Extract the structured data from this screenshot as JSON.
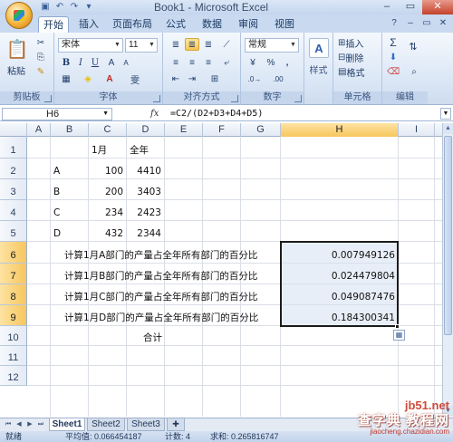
{
  "window": {
    "title": "Book1 - Microsoft Excel",
    "controls": [
      "–",
      "▭",
      "✕"
    ]
  },
  "quick_access": [
    "save-icon",
    "undo-icon",
    "redo-icon",
    "customize-icon"
  ],
  "tabs": [
    {
      "label": "开始",
      "active": true
    },
    {
      "label": "插入",
      "active": false
    },
    {
      "label": "页面布局",
      "active": false
    },
    {
      "label": "公式",
      "active": false
    },
    {
      "label": "数据",
      "active": false
    },
    {
      "label": "审阅",
      "active": false
    },
    {
      "label": "视图",
      "active": false
    }
  ],
  "ribbon": {
    "clipboard": {
      "label": "剪贴板",
      "paste": "粘贴"
    },
    "font": {
      "label": "字体",
      "name": "宋体",
      "size": "11"
    },
    "alignment": {
      "label": "对齐方式"
    },
    "number": {
      "label": "数字",
      "format": "常规"
    },
    "styles": {
      "label": "样式"
    },
    "cells": {
      "label": "单元格",
      "insert": "插入",
      "delete": "删除",
      "format": "格式"
    },
    "editing": {
      "label": "编辑"
    }
  },
  "formula_bar": {
    "name_box": "H6",
    "fx": "fx",
    "formula": "=C2/(D2+D3+D4+D5)"
  },
  "columns": [
    "A",
    "B",
    "C",
    "D",
    "E",
    "F",
    "G",
    "H",
    "I"
  ],
  "selected_column": "H",
  "rows": [
    "1",
    "2",
    "3",
    "4",
    "5",
    "6",
    "7",
    "8",
    "9",
    "10",
    "11",
    "12"
  ],
  "selected_rows": [
    "6",
    "7",
    "8",
    "9"
  ],
  "cells": {
    "C1": "1月",
    "D1": "全年",
    "B2": "A",
    "C2": "100",
    "D2": "4410",
    "B3": "B",
    "C3": "200",
    "D3": "3403",
    "B4": "C",
    "C4": "234",
    "D4": "2423",
    "B5": "D",
    "C5": "432",
    "D5": "2344",
    "B6": "计算1月A部门的产量占全年所有部门的百分比",
    "H6": "0.007949126",
    "B7": "计算1月B部门的产量占全年所有部门的百分比",
    "H7": "0.024479804",
    "B8": "计算1月C部门的产量占全年所有部门的百分比",
    "H8": "0.049087476",
    "B9": "计算1月D部门的产量占全年所有部门的百分比",
    "H9": "0.184300341",
    "D10": "合计"
  },
  "sheets": [
    {
      "label": "Sheet1",
      "active": true
    },
    {
      "label": "Sheet2",
      "active": false
    },
    {
      "label": "Sheet3",
      "active": false
    }
  ],
  "status": {
    "ready": "就绪",
    "average": "平均值: 0.066454187",
    "count": "计数: 4",
    "sum": "求和: 0.265816747"
  },
  "watermark": {
    "line1": "jb51.net",
    "line2": "查字典 教程网",
    "line3": "jiaocheng.chazidian.com"
  },
  "colors": {
    "accent": "#f7c65e",
    "ribbon_bg": "#dae6f5",
    "grid_line": "#dadfe6",
    "selection": "#d6e0f0"
  }
}
